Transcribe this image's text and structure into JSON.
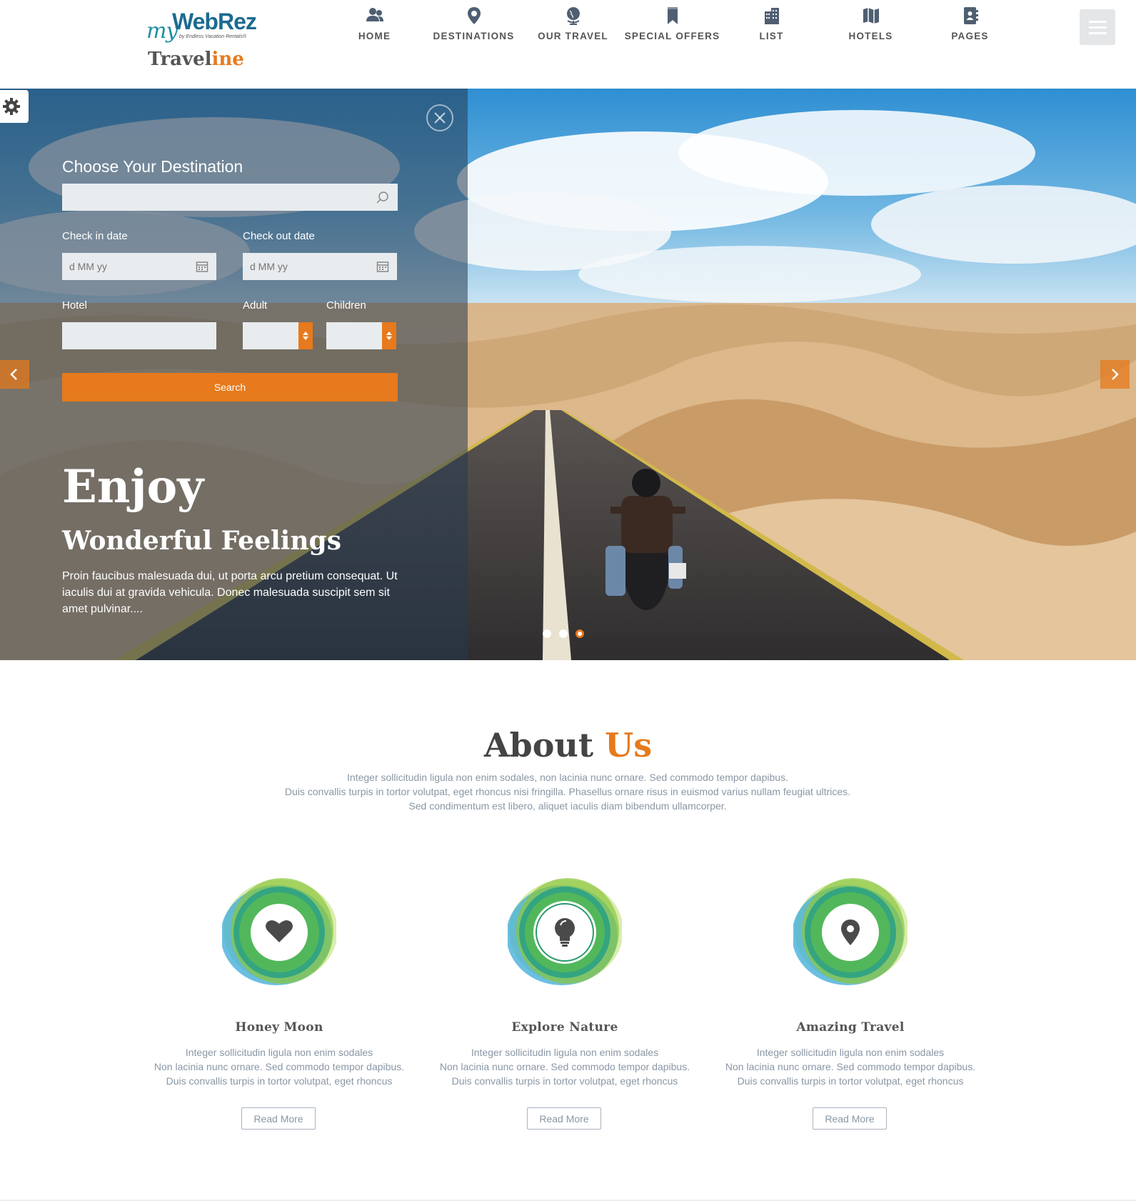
{
  "brand": {
    "logo_my": "my",
    "logo_webrez": "WebRez",
    "logo_tagline": "by Endless Vacation Rentals®",
    "logo_text_main": "Travel",
    "logo_text_accent": "ine",
    "accent_color": "#e67a1c",
    "brand_blue": "#1c6b8f"
  },
  "nav": {
    "items": [
      {
        "label": "HOME",
        "icon": "users-icon"
      },
      {
        "label": "DESTINATIONS",
        "icon": "map-pin-icon"
      },
      {
        "label": "OUR TRAVEL",
        "icon": "globe-icon"
      },
      {
        "label": "SPECIAL OFFERS",
        "icon": "bookmark-icon"
      },
      {
        "label": "LIST",
        "icon": "building-icon"
      },
      {
        "label": "HOTELS",
        "icon": "map-icon"
      },
      {
        "label": "PAGES",
        "icon": "contact-book-icon"
      }
    ],
    "menu_icon": "hamburger-menu-icon"
  },
  "booking": {
    "title": "Choose Your Destination",
    "destination_value": "",
    "check_in_label": "Check in date",
    "check_in_placeholder": "d MM yy",
    "check_out_label": "Check out date",
    "check_out_placeholder": "d MM yy",
    "hotel_label": "Hotel",
    "adult_label": "Adult",
    "children_label": "Children",
    "search_label": "Search"
  },
  "hero": {
    "title": "Enjoy",
    "subtitle": "Wonderful Feelings",
    "description": "Proin faucibus malesuada dui, ut porta arcu pretium consequat. Ut iaculis dui at gravida vehicula. Donec malesuada suscipit sem sit amet pulvinar....",
    "slide_count": 3,
    "active_slide": 3
  },
  "about": {
    "title_main": "About",
    "title_accent": "Us",
    "line1": "Integer sollicitudin ligula non enim sodales, non lacinia nunc ornare. Sed commodo tempor dapibus.",
    "line2": "Duis convallis turpis in tortor volutpat, eget rhoncus nisi fringilla. Phasellus ornare risus in euismod varius nullam feugiat ultrices.",
    "line3": "Sed condimentum est libero, aliquet iaculis diam bibendum ullamcorper."
  },
  "features": [
    {
      "title": "Honey Moon",
      "icon": "heart-icon",
      "line1": "Integer sollicitudin ligula non enim sodales",
      "line2": "Non lacinia nunc ornare. Sed commodo tempor dapibus.",
      "line3": "Duis convallis turpis in tortor volutpat, eget rhoncus",
      "button": "Read More"
    },
    {
      "title": "Explore Nature",
      "icon": "lightbulb-icon",
      "line1": "Integer sollicitudin ligula non enim sodales",
      "line2": "Non lacinia nunc ornare. Sed commodo tempor dapibus.",
      "line3": "Duis convallis turpis in tortor volutpat, eget rhoncus",
      "button": "Read More"
    },
    {
      "title": "Amazing Travel",
      "icon": "map-pin-icon",
      "line1": "Integer sollicitudin ligula non enim sodales",
      "line2": "Non lacinia nunc ornare. Sed commodo tempor dapibus.",
      "line3": "Duis convallis turpis in tortor volutpat, eget rhoncus",
      "button": "Read More"
    }
  ]
}
